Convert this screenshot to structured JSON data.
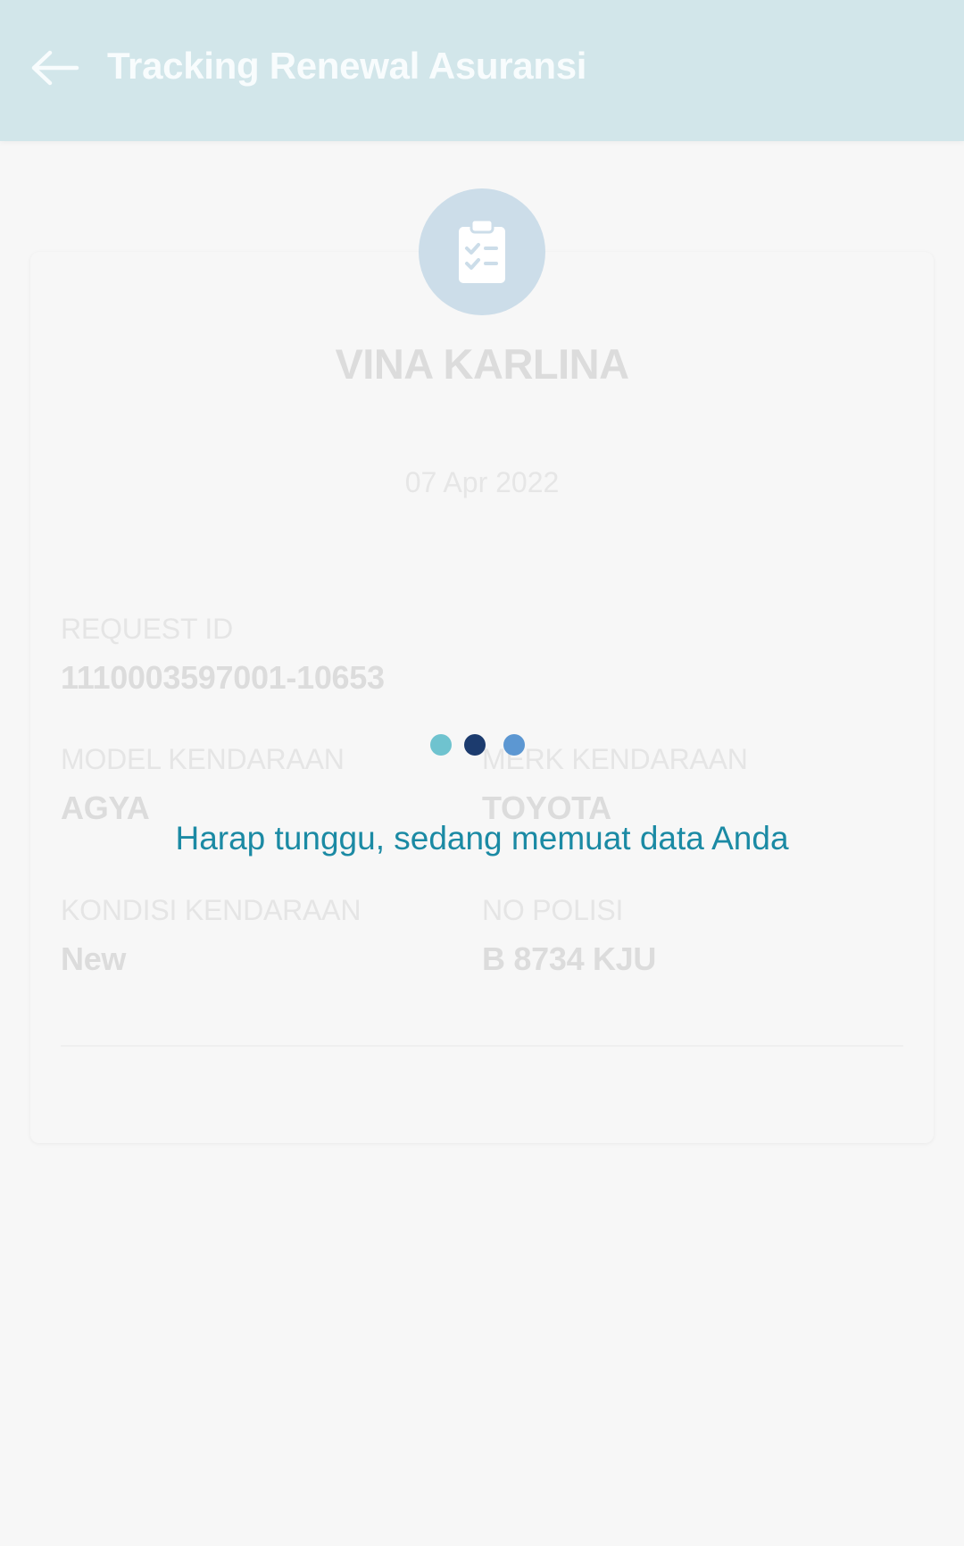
{
  "header": {
    "title": "Tracking Renewal Asuransi",
    "back_icon": "arrow-left-icon"
  },
  "card": {
    "avatar_icon": "clipboard-checklist-icon",
    "customer_name": "VINA KARLINA",
    "date": "07 Apr 2022",
    "fields": {
      "request_id": {
        "label": "REQUEST ID",
        "value": "1110003597001-10653"
      },
      "model": {
        "label": "MODEL KENDARAAN",
        "value": "AGYA"
      },
      "brand": {
        "label": "MERK KENDARAAN",
        "value": "TOYOTA"
      },
      "condition": {
        "label": "KONDISI KENDARAAN",
        "value": "New"
      },
      "plate": {
        "label": "NO POLISI",
        "value": "B 8734 KJU"
      }
    }
  },
  "loading": {
    "message": "Harap tunggu, sedang memuat data Anda",
    "dot_colors": [
      "#6fc3cf",
      "#1c3b6e",
      "#5c97d2"
    ]
  },
  "colors": {
    "header_bg": "#d2e6ea",
    "avatar_bg": "#ccdde9",
    "loading_text": "#1b8aa4"
  }
}
